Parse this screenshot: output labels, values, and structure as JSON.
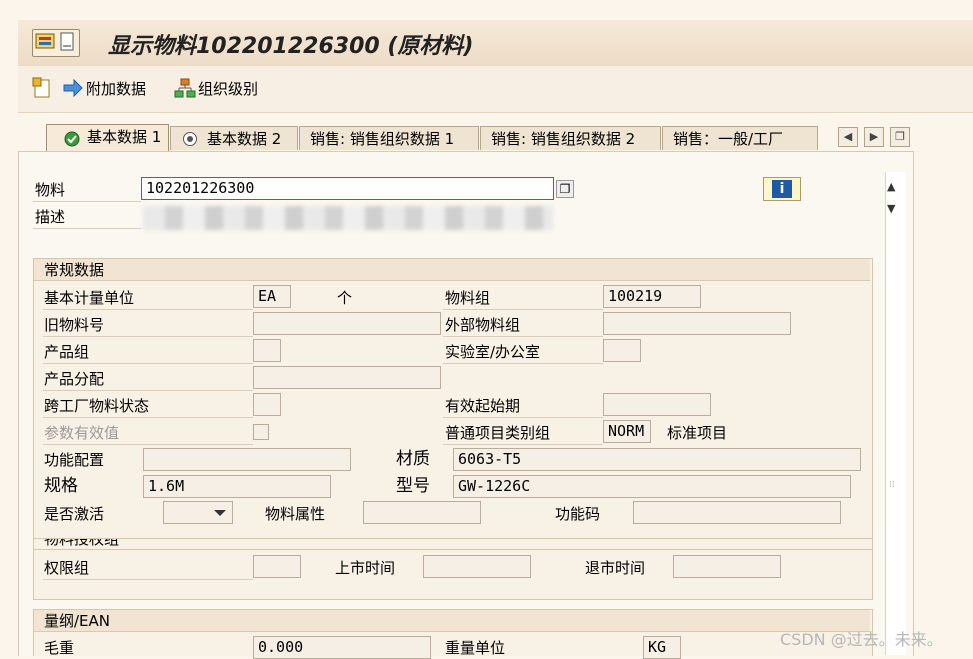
{
  "window": {
    "title": "显示物料102201226300 (原材料)"
  },
  "toolbar": {
    "additional_data": "附加数据",
    "org_levels": "组织级别"
  },
  "tabs": [
    {
      "label": "基本数据 1"
    },
    {
      "label": "基本数据 2"
    },
    {
      "label": "销售: 销售组织数据 1"
    },
    {
      "label": "销售: 销售组织数据 2"
    },
    {
      "label": "销售：一般/工厂"
    }
  ],
  "header": {
    "material_label": "物料",
    "material_value": "102201226300",
    "description_label": "描述"
  },
  "general": {
    "title": "常规数据",
    "base_uom_label": "基本计量单位",
    "base_uom_value": "EA",
    "base_uom_text": "个",
    "material_group_label": "物料组",
    "material_group_value": "100219",
    "old_material_label": "旧物料号",
    "ext_material_group_label": "外部物料组",
    "product_group_label": "产品组",
    "lab_office_label": "实验室/办公室",
    "product_alloc_label": "产品分配",
    "x_plant_status_label": "跨工厂物料状态",
    "valid_from_label": "有效起始期",
    "param_effectivity_label": "参数有效值",
    "item_cat_group_label": "普通项目类别组",
    "item_cat_group_value": "NORM",
    "item_cat_group_text": "标准项目",
    "func_config_label": "功能配置",
    "material_label": "材质",
    "material_value": "6063-T5",
    "spec_label": "规格",
    "spec_value": "1.6M",
    "model_label": "型号",
    "model_value": "GW-1226C",
    "active_label": "是否激活",
    "attr_label": "物料属性",
    "func_code_label": "功能码"
  },
  "auth": {
    "partial_header": "物料授权组",
    "auth_group_label": "权限组",
    "launch_time_label": "上市时间",
    "withdraw_time_label": "退市时间"
  },
  "dims": {
    "title": "量纲/EAN",
    "gross_weight_label": "毛重",
    "gross_weight_value": "0.000",
    "weight_unit_label": "重量单位",
    "weight_unit_value": "KG"
  },
  "watermark": "CSDN @过去。未来。"
}
